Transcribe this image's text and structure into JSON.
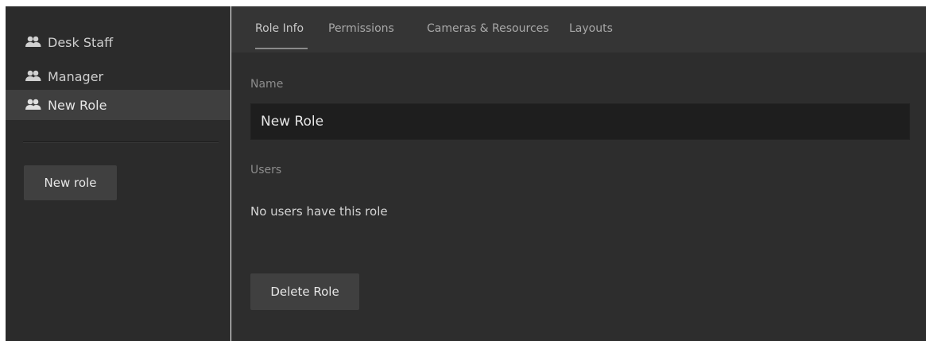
{
  "sidebar": {
    "roles": [
      {
        "label": "Desk Staff",
        "icon": "users-icon",
        "selected": false
      },
      {
        "label": "Manager",
        "icon": "users-icon",
        "selected": false
      },
      {
        "label": "New Role",
        "icon": "users-icon",
        "selected": true
      }
    ],
    "new_role_button": "New role"
  },
  "tabs": [
    {
      "label": "Role Info",
      "active": true
    },
    {
      "label": "Permissions",
      "active": false
    },
    {
      "label": "Cameras & Resources",
      "active": false
    },
    {
      "label": "Layouts",
      "active": false
    }
  ],
  "role_info": {
    "name_label": "Name",
    "name_value": "New Role",
    "users_label": "Users",
    "users_text": "No users have this role",
    "delete_button": "Delete Role"
  },
  "colors": {
    "sidebar_bg": "#2b2b2b",
    "main_bg": "#2d2d2d",
    "tabbar_bg": "#353535",
    "selected_bg": "#3f3f3f",
    "input_bg": "#1e1e1e",
    "button_bg": "#404040"
  }
}
